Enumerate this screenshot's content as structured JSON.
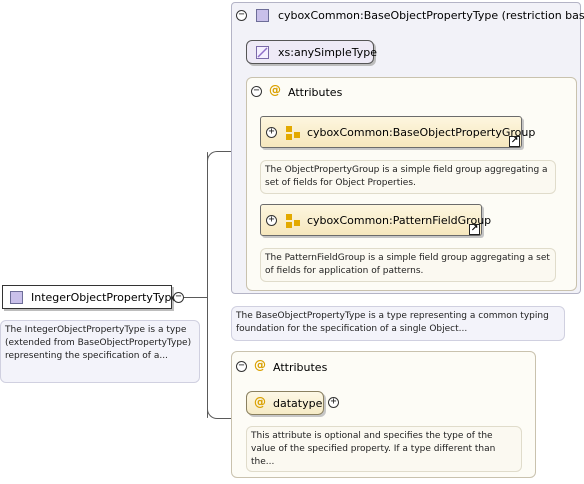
{
  "root": {
    "name": "IntegerObjectPropertyType",
    "description": "The IntegerObjectPropertyType is a type (extended from BaseObjectPropertyType) representing the specification of a..."
  },
  "base": {
    "title": "cyboxCommon:BaseObjectPropertyType (restriction base)",
    "simple_type": "xs:anySimpleType",
    "attributes_label": "Attributes",
    "groups": [
      {
        "name": "cyboxCommon:BaseObjectPropertyGroup",
        "description": "The ObjectPropertyGroup is a simple field group aggregating a set of fields for Object Properties."
      },
      {
        "name": "cyboxCommon:PatternFieldGroup",
        "description": "The PatternFieldGroup is a simple field group aggregating a set of fields for application of patterns."
      }
    ],
    "description": "The BaseObjectPropertyType is a type representing a common typing foundation for the specification of a single Object..."
  },
  "own_attributes": {
    "label": "Attributes",
    "attribute": {
      "name": "datatype",
      "description": "This attribute is optional and specifies the type of the value of the specified property. If a type different than the..."
    }
  },
  "icons": {
    "collapse": "minus-circle-icon",
    "expand": "plus-circle-icon",
    "attribute": "at-sign-icon",
    "group": "attribute-group-icon",
    "link": "link-arrow-icon",
    "type": "complex-type-icon"
  }
}
